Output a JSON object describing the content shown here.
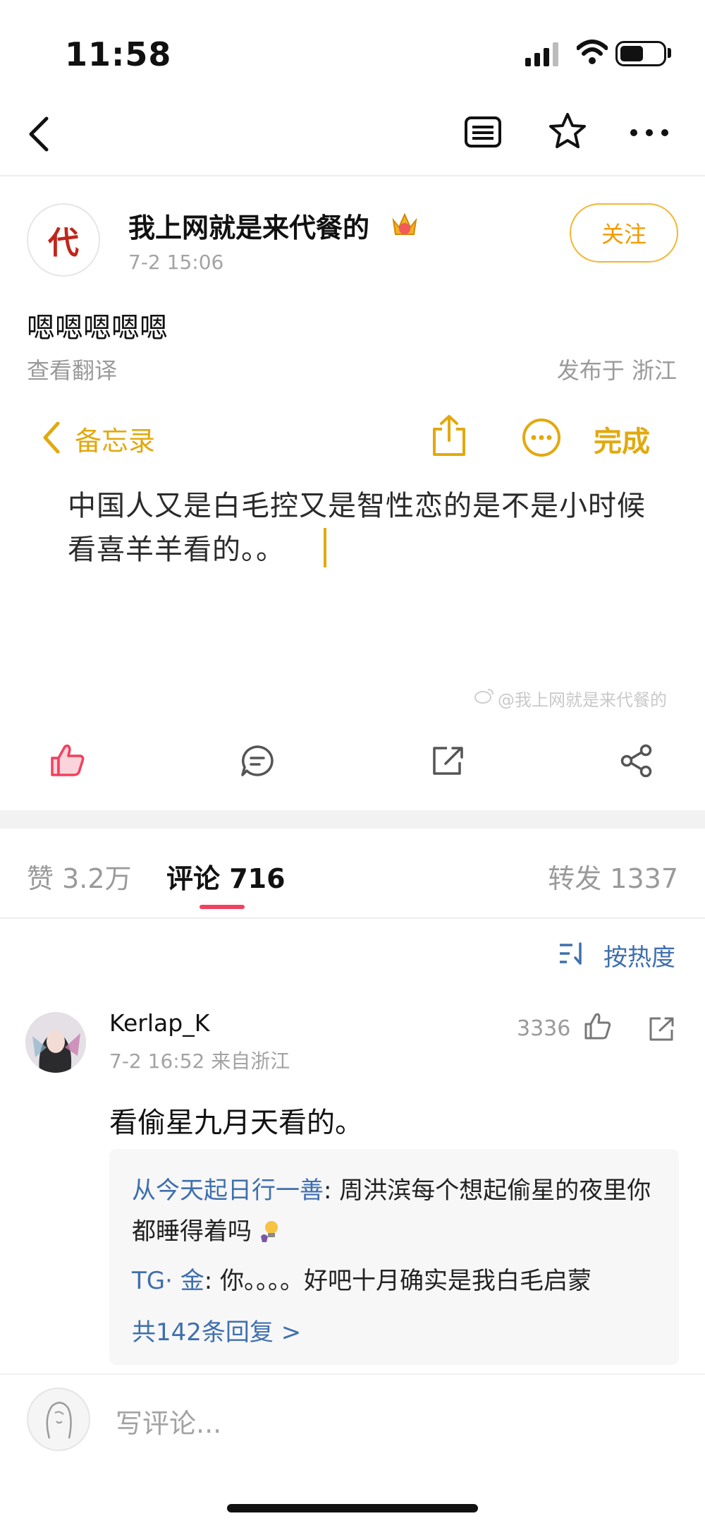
{
  "status_bar": {
    "time": "11:58"
  },
  "nav": {
    "back_icon": "chevron-left-icon",
    "list_icon": "list-icon",
    "star_icon": "star-icon",
    "more_icon": "more-icon"
  },
  "author": {
    "avatar_char": "代",
    "name": "我上网就是来代餐的",
    "time": "7-2 15:06",
    "follow_label": "关注"
  },
  "post": {
    "text": "嗯嗯嗯嗯嗯",
    "translate": "查看翻译",
    "location": "发布于 浙江"
  },
  "memo": {
    "back_label": "备忘录",
    "done_label": "完成",
    "text": "中国人又是白毛控又是智性恋的是不是小时候看喜羊羊看的。。",
    "watermark": "@我上网就是来代餐的"
  },
  "tabs": {
    "likes": "赞 3.2万",
    "comments": "评论 716",
    "reposts": "转发 1337"
  },
  "sort": {
    "label": "按热度"
  },
  "comment": {
    "user": "Kerlap_K",
    "meta": "7-2 16:52   来自浙江",
    "like_count": "3336",
    "text": "看偷星九月天看的。",
    "replies": [
      {
        "name": "从今天起日行一善",
        "text": ": 周洪滨每个想起偷星的夜里你都睡得着吗"
      },
      {
        "name": "TG· 金",
        "text": ": 你。。。。好吧十月确实是我白毛启蒙"
      }
    ],
    "more_replies": "共142条回复 >"
  },
  "bottom": {
    "input_placeholder": "写评论..."
  },
  "colors": {
    "accent_orange": "#f39a00",
    "link_blue": "#3f6fae",
    "tab_underline": "#f0415f",
    "like_red": "#f0415f"
  }
}
